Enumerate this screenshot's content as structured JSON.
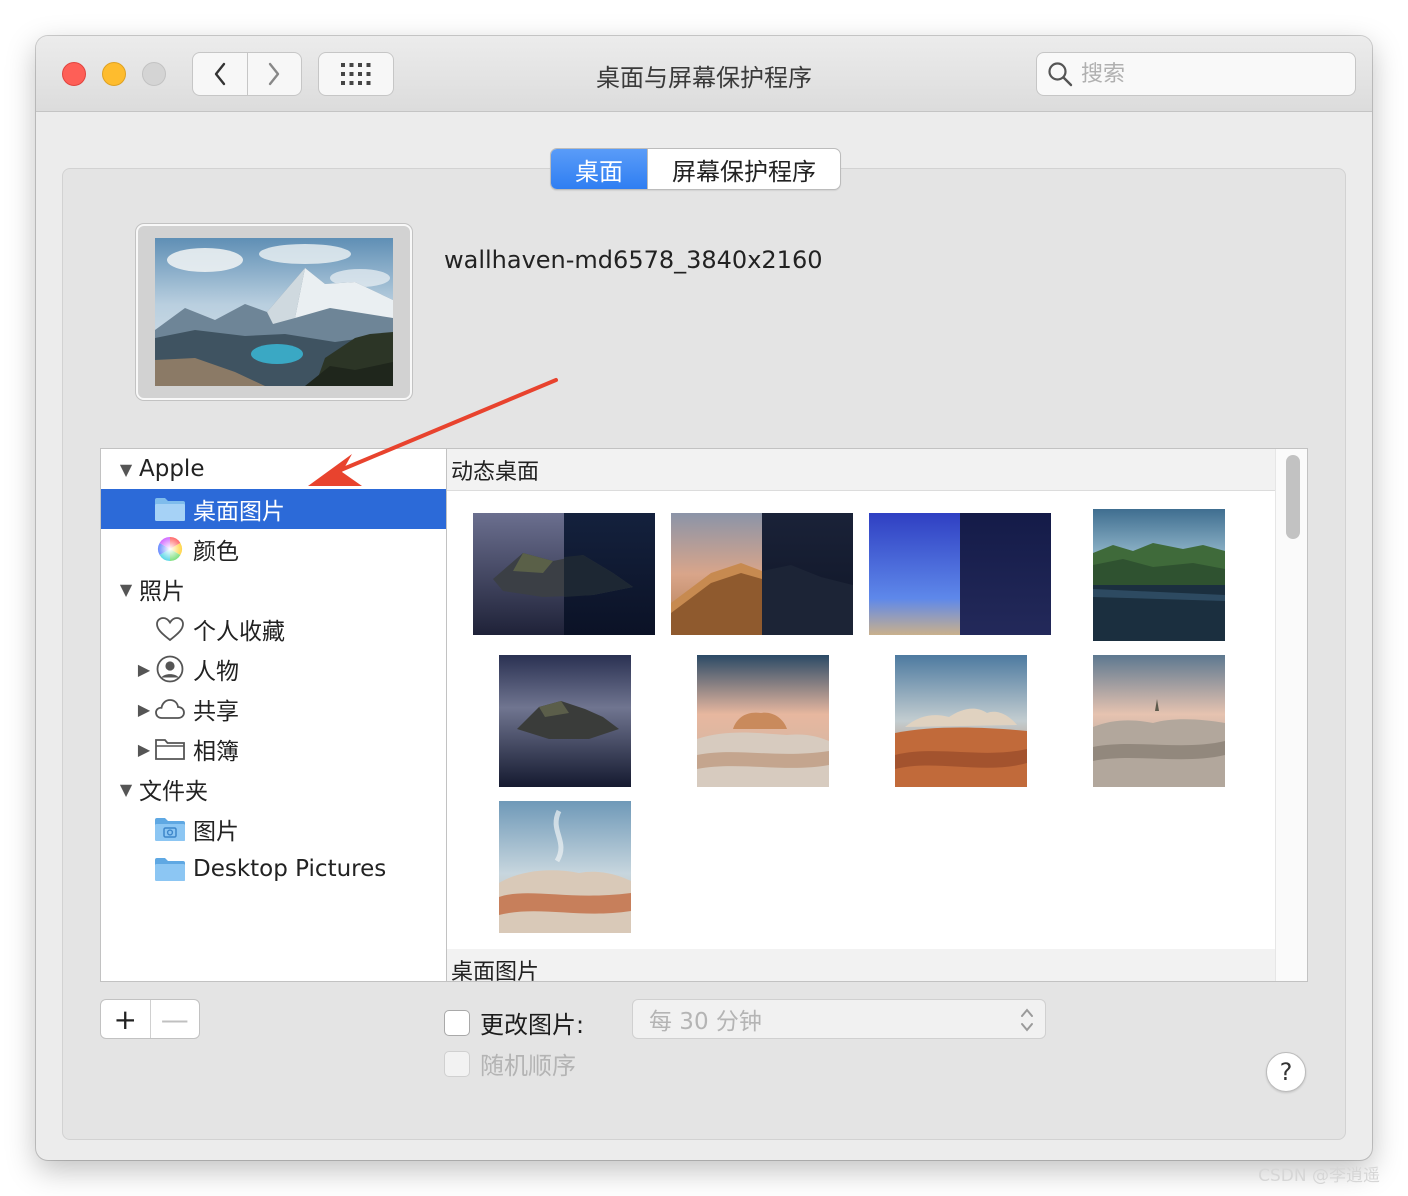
{
  "window": {
    "title": "桌面与屏幕保护程序",
    "search_placeholder": "搜索"
  },
  "tabs": [
    {
      "label": "桌面",
      "active": true
    },
    {
      "label": "屏幕保护程序",
      "active": false
    }
  ],
  "current_wallpaper": {
    "name": "wallhaven-md6578_3840x2160"
  },
  "sources": {
    "apple": {
      "label": "Apple",
      "items": [
        "桌面图片",
        "颜色"
      ]
    },
    "photos": {
      "label": "照片",
      "items": [
        "个人收藏",
        "人物",
        "共享",
        "相簿"
      ]
    },
    "folders": {
      "label": "文件夹",
      "items": [
        "图片",
        "Desktop Pictures"
      ]
    }
  },
  "grid": {
    "section_dynamic": "动态桌面",
    "section_desktop": "桌面图片"
  },
  "controls": {
    "add_label": "+",
    "remove_label": "—",
    "change_picture_label": "更改图片:",
    "change_picture_checked": false,
    "interval_value": "每 30 分钟",
    "random_order_label": "随机顺序",
    "random_order_checked": false,
    "help_label": "?"
  },
  "watermark": "CSDN @李逍遥",
  "colors": {
    "selection": "#2c6ad8",
    "tab_active": "#2f7ef2",
    "annotation_arrow": "#e8432e"
  }
}
